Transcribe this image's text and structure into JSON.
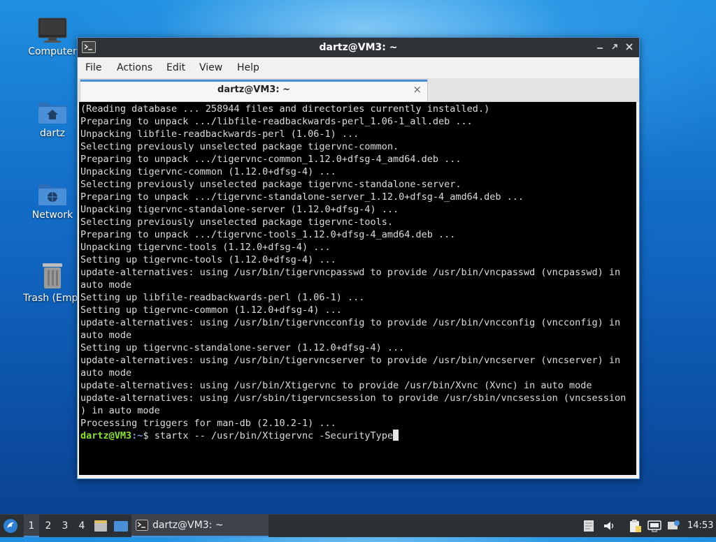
{
  "desktop": {
    "icons": [
      {
        "label": "Computer",
        "icon": "monitor-icon"
      },
      {
        "label": "dartz",
        "icon": "home-folder-icon"
      },
      {
        "label": "Network",
        "icon": "network-folder-icon"
      },
      {
        "label": "Trash (Empt",
        "icon": "trash-icon"
      }
    ]
  },
  "window": {
    "title": "dartz@VM3: ~",
    "controls": [
      "minimize-icon",
      "maximize-icon",
      "close-icon"
    ],
    "menu": [
      "File",
      "Actions",
      "Edit",
      "View",
      "Help"
    ],
    "tab": {
      "label": "dartz@VM3: ~",
      "close": "×"
    }
  },
  "terminal": {
    "lines": [
      "(Reading database ... 258944 files and directories currently installed.)",
      "Preparing to unpack .../libfile-readbackwards-perl_1.06-1_all.deb ...",
      "Unpacking libfile-readbackwards-perl (1.06-1) ...",
      "Selecting previously unselected package tigervnc-common.",
      "Preparing to unpack .../tigervnc-common_1.12.0+dfsg-4_amd64.deb ...",
      "Unpacking tigervnc-common (1.12.0+dfsg-4) ...",
      "Selecting previously unselected package tigervnc-standalone-server.",
      "Preparing to unpack .../tigervnc-standalone-server_1.12.0+dfsg-4_amd64.deb ...",
      "Unpacking tigervnc-standalone-server (1.12.0+dfsg-4) ...",
      "Selecting previously unselected package tigervnc-tools.",
      "Preparing to unpack .../tigervnc-tools_1.12.0+dfsg-4_amd64.deb ...",
      "Unpacking tigervnc-tools (1.12.0+dfsg-4) ...",
      "Setting up tigervnc-tools (1.12.0+dfsg-4) ...",
      "update-alternatives: using /usr/bin/tigervncpasswd to provide /usr/bin/vncpasswd (vncpasswd) in",
      "auto mode",
      "Setting up libfile-readbackwards-perl (1.06-1) ...",
      "Setting up tigervnc-common (1.12.0+dfsg-4) ...",
      "update-alternatives: using /usr/bin/tigervncconfig to provide /usr/bin/vncconfig (vncconfig) in",
      "auto mode",
      "Setting up tigervnc-standalone-server (1.12.0+dfsg-4) ...",
      "update-alternatives: using /usr/bin/tigervncserver to provide /usr/bin/vncserver (vncserver) in",
      "auto mode",
      "update-alternatives: using /usr/bin/Xtigervnc to provide /usr/bin/Xvnc (Xvnc) in auto mode",
      "update-alternatives: using /usr/sbin/tigervncsession to provide /usr/sbin/vncsession (vncsession",
      ") in auto mode",
      "Processing triggers for man-db (2.10.2-1) ..."
    ],
    "prompt_user": "dartz@VM3",
    "prompt_sep": ":",
    "prompt_path": "~",
    "prompt_symbol": "$",
    "command": " startx -- /usr/bin/Xtigervnc -SecurityType"
  },
  "taskbar": {
    "workspaces": [
      "1",
      "2",
      "3",
      "4"
    ],
    "active_workspace": "1",
    "task_label": "dartz@VM3: ~",
    "clock": "14:53",
    "tray_icons": [
      "notes-icon",
      "volume-icon",
      "clipboard-icon",
      "network-wired-icon",
      "updates-icon"
    ]
  },
  "colors": {
    "accent": "#4a90d9",
    "terminal_bg": "#000000",
    "prompt_user": "#8ae234",
    "prompt_path": "#729fcf"
  }
}
